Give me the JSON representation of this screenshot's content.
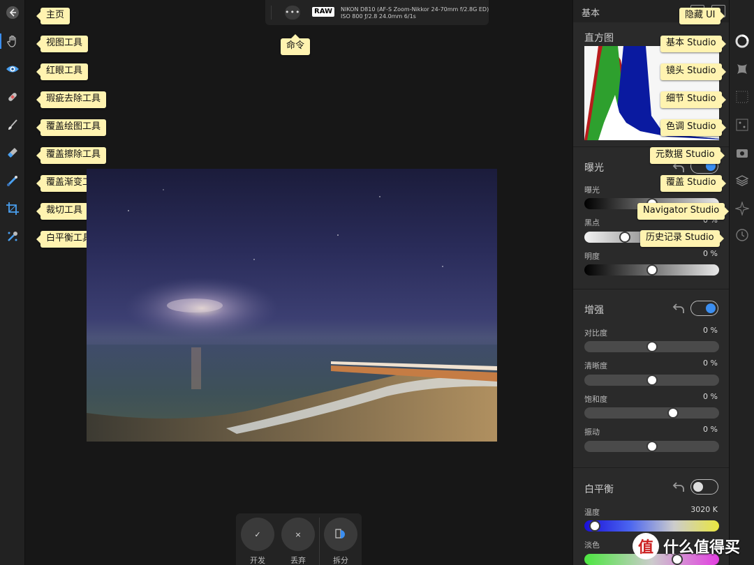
{
  "tooltips": {
    "home": "主页",
    "view_tool": "视图工具",
    "red_eye_tool": "红眼工具",
    "blemish_tool": "瑕疵去除工具",
    "overlay_paint_tool": "覆盖绘图工具",
    "overlay_erase_tool": "覆盖擦除工具",
    "overlay_gradient_tool": "覆盖渐变工具",
    "crop_tool": "裁切工具",
    "white_balance_tool": "白平衡工具",
    "command": "命令",
    "hide_ui": "隐藏 UI",
    "basic_studio": "基本 Studio",
    "lens_studio": "镜头 Studio",
    "detail_studio": "细节 Studio",
    "tone_studio": "色调 Studio",
    "metadata_studio": "元数据 Studio",
    "overlay_studio": "覆盖 Studio",
    "navigator_studio": "Navigator Studio",
    "history_studio": "历史记录 Studio"
  },
  "info_bar": {
    "more": "•••",
    "raw_badge": "RAW",
    "camera_line1": "NIKON D810 (AF-S Zoom-Nikkor 24-70mm f/2.8G ED)",
    "camera_line2": "ISO 800 ƒ/2.8 24.0mm 6/1s"
  },
  "bottom_bar": {
    "develop_label": "开发",
    "discard_label": "丢弃",
    "split_label": "拆分",
    "develop_icon": "✓",
    "discard_icon": "×"
  },
  "panel": {
    "title": "基本",
    "histogram_title": "直方图",
    "exposure_section": {
      "title": "曝光",
      "enabled": true,
      "sliders": [
        {
          "label": "曝光",
          "value": "0 %",
          "fraction": 0.5
        },
        {
          "label": "黑点",
          "value": "0 %",
          "fraction": 0.3
        },
        {
          "label": "明度",
          "value": "0 %",
          "fraction": 0.5
        }
      ]
    },
    "enhance_section": {
      "title": "增强",
      "enabled": true,
      "sliders": [
        {
          "label": "对比度",
          "value": "0 %",
          "fraction": 0.5
        },
        {
          "label": "清晰度",
          "value": "0 %",
          "fraction": 0.5
        },
        {
          "label": "饱和度",
          "value": "0 %",
          "fraction": 0.66
        },
        {
          "label": "振动",
          "value": "0 %",
          "fraction": 0.5
        }
      ]
    },
    "white_balance_section": {
      "title": "白平衡",
      "enabled": false,
      "sliders": [
        {
          "label": "温度",
          "value": "3020 K",
          "fraction": 0.08
        },
        {
          "label": "淡色",
          "value": "",
          "fraction": 0.69
        }
      ]
    }
  },
  "watermark": {
    "circle": "值",
    "text": "什么值得买"
  },
  "colors": {
    "accent": "#3b8ef0",
    "tooltip_bg": "#fff3b0",
    "panel_bg": "#2a2a2a"
  }
}
